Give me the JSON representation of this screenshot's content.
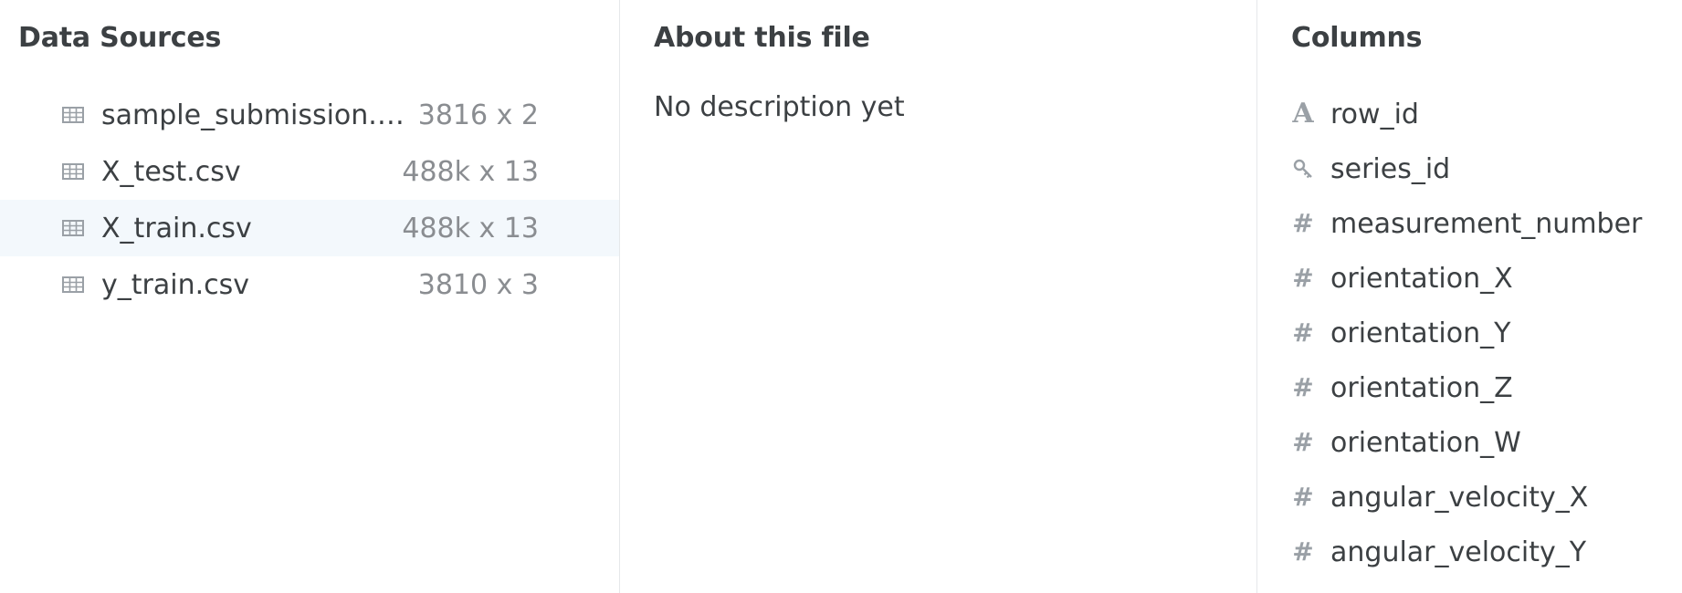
{
  "sources_panel": {
    "title": "Data Sources",
    "files": [
      {
        "name": "sample_submission.c...",
        "dims": "3816 x 2",
        "icon": "table-icon",
        "selected": false
      },
      {
        "name": "X_test.csv",
        "dims": "488k x 13",
        "icon": "table-icon",
        "selected": false
      },
      {
        "name": "X_train.csv",
        "dims": "488k x 13",
        "icon": "table-icon",
        "selected": true
      },
      {
        "name": "y_train.csv",
        "dims": "3810 x 3",
        "icon": "table-icon",
        "selected": false
      }
    ]
  },
  "about_panel": {
    "title": "About this file",
    "description": "No description yet"
  },
  "columns_panel": {
    "title": "Columns",
    "columns": [
      {
        "name": "row_id",
        "type_icon": "string-type-icon",
        "glyph": "A"
      },
      {
        "name": "series_id",
        "type_icon": "key-icon",
        "glyph": ""
      },
      {
        "name": "measurement_number",
        "type_icon": "numeric-type-icon",
        "glyph": "#"
      },
      {
        "name": "orientation_X",
        "type_icon": "numeric-type-icon",
        "glyph": "#"
      },
      {
        "name": "orientation_Y",
        "type_icon": "numeric-type-icon",
        "glyph": "#"
      },
      {
        "name": "orientation_Z",
        "type_icon": "numeric-type-icon",
        "glyph": "#"
      },
      {
        "name": "orientation_W",
        "type_icon": "numeric-type-icon",
        "glyph": "#"
      },
      {
        "name": "angular_velocity_X",
        "type_icon": "numeric-type-icon",
        "glyph": "#"
      },
      {
        "name": "angular_velocity_Y",
        "type_icon": "numeric-type-icon",
        "glyph": "#"
      }
    ]
  },
  "colors": {
    "text": "#3c4043",
    "muted": "#8a8d91",
    "icon": "#9aa0a6",
    "selected_row": "#f3f8fc",
    "divider": "#e6e8ea"
  }
}
